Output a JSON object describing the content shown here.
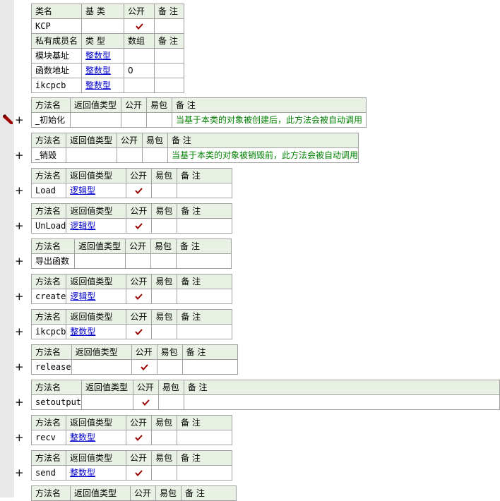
{
  "colors": {
    "header_bg": "#e8f1e4",
    "border": "#a0a0a0",
    "link": "#0000cc",
    "note": "#008000",
    "check": "#990000",
    "gutter": "#e8e8e8"
  },
  "icons": {
    "expand": "plus-icon",
    "check": "checkmark-icon",
    "breakpoint": "pencil-icon"
  },
  "class_table": {
    "header": [
      "类名",
      "基 类",
      "公开",
      "备 注"
    ],
    "row": {
      "name": "KCP",
      "base": "",
      "public": true,
      "note": ""
    }
  },
  "members_table": {
    "header": [
      "私有成员名",
      "类 型",
      "数组",
      "备 注"
    ],
    "rows": [
      {
        "name": "模块基址",
        "type": "整数型",
        "array": "",
        "note": ""
      },
      {
        "name": "函数地址",
        "type": "整数型",
        "array": "0",
        "note": ""
      },
      {
        "name": "ikcpcb",
        "type": "整数型",
        "array": "",
        "note": ""
      }
    ]
  },
  "method_header": [
    "方法名",
    "返回值类型",
    "公开",
    "易包",
    "备 注"
  ],
  "expand_symbol": "+",
  "check_symbol": "✓",
  "methods": [
    {
      "name": "_初始化",
      "return_type": "",
      "public": false,
      "easy": "",
      "note": "当基于本类的对象被创建后，此方法会被自动调用"
    },
    {
      "name": "_销毁",
      "return_type": "",
      "public": false,
      "easy": "",
      "note": "当基于本类的对象被销毁前，此方法会被自动调用"
    },
    {
      "name": "Load",
      "return_type": "逻辑型",
      "public": true,
      "easy": "",
      "note": ""
    },
    {
      "name": "UnLoad",
      "return_type": "逻辑型",
      "public": true,
      "easy": "",
      "note": ""
    },
    {
      "name": "导出函数",
      "return_type": "",
      "public": false,
      "easy": "",
      "note": ""
    },
    {
      "name": "create",
      "return_type": "逻辑型",
      "public": true,
      "easy": "",
      "note": ""
    },
    {
      "name": "ikcpcb",
      "return_type": "整数型",
      "public": true,
      "easy": "",
      "note": ""
    },
    {
      "name": "release",
      "return_type": "",
      "public": true,
      "easy": "",
      "note": ""
    },
    {
      "name": "setoutput",
      "return_type": "",
      "public": true,
      "easy": "",
      "note": ""
    },
    {
      "name": "recv",
      "return_type": "整数型",
      "public": true,
      "easy": "",
      "note": ""
    },
    {
      "name": "send",
      "return_type": "整数型",
      "public": true,
      "easy": "",
      "note": ""
    },
    {
      "name": "",
      "return_type": "",
      "public": false,
      "easy": "",
      "note": ""
    }
  ]
}
